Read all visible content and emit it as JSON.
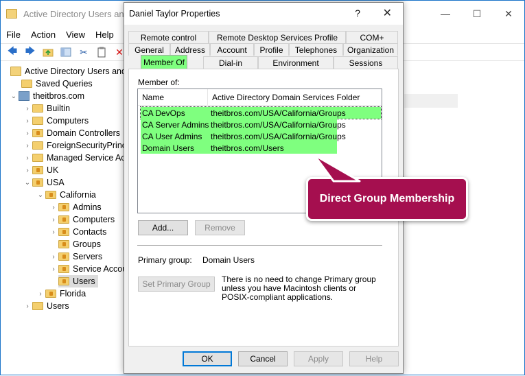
{
  "background_window": {
    "title": "Active Directory Users and C",
    "controls": {
      "minimize": "—",
      "maximize": "☐",
      "close": "✕"
    },
    "menu": [
      "File",
      "Action",
      "View",
      "Help"
    ],
    "tree": [
      {
        "label": "Active Directory Users and C",
        "type": "root"
      },
      {
        "label": "Saved Queries",
        "type": "folder"
      },
      {
        "label": "theitbros.com",
        "type": "domain"
      },
      {
        "label": "Builtin",
        "type": "folder"
      },
      {
        "label": "Computers",
        "type": "folder"
      },
      {
        "label": "Domain Controllers",
        "type": "ou"
      },
      {
        "label": "ForeignSecurityPrinc",
        "type": "folder"
      },
      {
        "label": "Managed Service Ac",
        "type": "folder"
      },
      {
        "label": "UK",
        "type": "ou"
      },
      {
        "label": "USA",
        "type": "ou"
      },
      {
        "label": "California",
        "type": "ou"
      },
      {
        "label": "Admins",
        "type": "ou"
      },
      {
        "label": "Computers",
        "type": "ou"
      },
      {
        "label": "Contacts",
        "type": "ou"
      },
      {
        "label": "Groups",
        "type": "ou"
      },
      {
        "label": "Servers",
        "type": "ou"
      },
      {
        "label": "Service Accou",
        "type": "ou"
      },
      {
        "label": "Users",
        "type": "ou",
        "selected": true
      },
      {
        "label": "Florida",
        "type": "ou"
      },
      {
        "label": "Users",
        "type": "folder"
      }
    ]
  },
  "dialog": {
    "title": "Daniel Taylor Properties",
    "help": "?",
    "close": "✕",
    "tabs_row1": [
      "Remote control",
      "Remote Desktop Services Profile",
      "COM+"
    ],
    "tabs_row2": [
      "General",
      "Address",
      "Account",
      "Profile",
      "Telephones",
      "Organization"
    ],
    "tabs_row3": [
      "Member Of",
      "Dial-in",
      "Environment",
      "Sessions"
    ],
    "member_of_label": "Member of:",
    "columns": [
      "Name",
      "Active Directory Domain Services Folder"
    ],
    "groups": [
      {
        "name": "CA DevOps",
        "folder": "theitbros.com/USA/California/Groups"
      },
      {
        "name": "CA Server Admins",
        "folder": "theitbros.com/USA/California/Groups"
      },
      {
        "name": "CA User Admins",
        "folder": "theitbros.com/USA/California/Groups"
      },
      {
        "name": "Domain Users",
        "folder": "theitbros.com/Users"
      }
    ],
    "add_button": "Add...",
    "remove_button": "Remove",
    "primary_group_label": "Primary group:",
    "primary_group_value": "Domain Users",
    "set_primary_button": "Set Primary Group",
    "note": "There is no need to change Primary group unless you have Macintosh clients or POSIX-compliant applications.",
    "ok_button": "OK",
    "cancel_button": "Cancel",
    "apply_button": "Apply",
    "help_button": "Help"
  },
  "callout": {
    "text": "Direct Group Membership"
  },
  "colors": {
    "highlight": "#7fff7f",
    "callout": "#a50f4f"
  }
}
